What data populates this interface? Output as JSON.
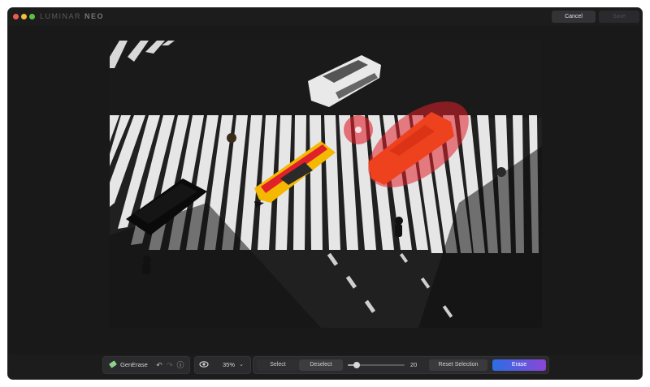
{
  "window": {
    "brand_light": "LUMINAR",
    "brand_bold": "NEO",
    "cancel_label": "Cancel",
    "save_label": "Save"
  },
  "photo": {
    "description_icon": "crosswalk-photo"
  },
  "toolbar": {
    "tool_name": "GenErase",
    "tool_icon": "eraser-icon",
    "zoom": "35%",
    "select_label": "Select",
    "deselect_label": "Deselect",
    "brush_size": "20",
    "brush_fraction": 0.15,
    "reset_label": "Reset Selection",
    "erase_label": "Erase"
  },
  "colors": {
    "erase_gradient_start": "#2c6ee6",
    "erase_gradient_end": "#8a46d6",
    "mask_red": "#e0202a",
    "taxi_yellow": "#f5b800"
  }
}
